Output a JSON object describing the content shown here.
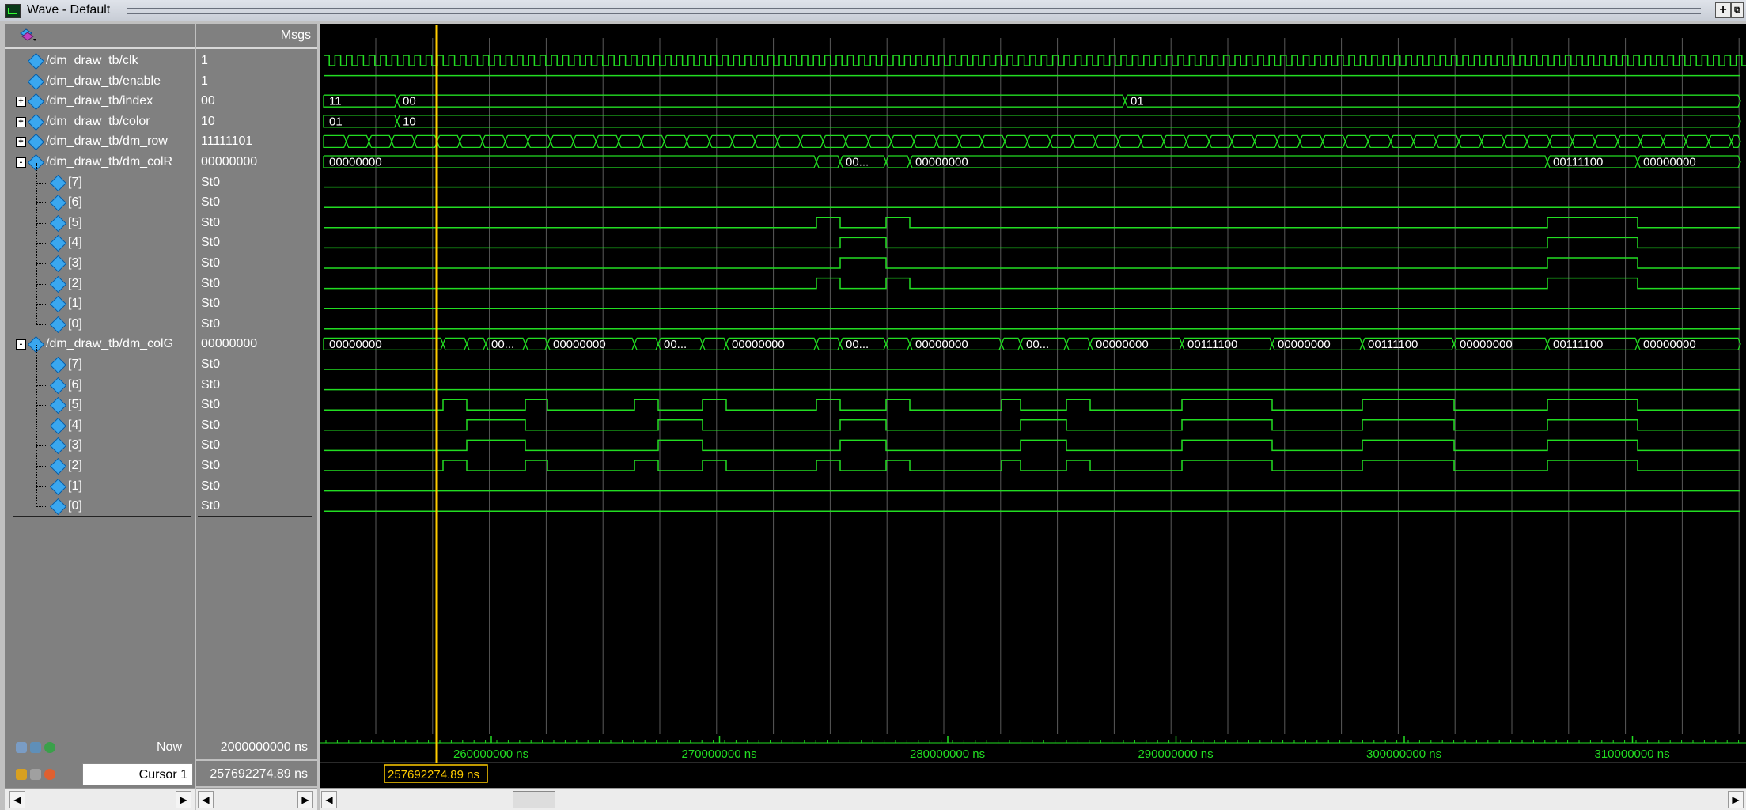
{
  "window": {
    "title": "Wave - Default"
  },
  "header": {
    "msgs_label": "Msgs"
  },
  "signals": [
    {
      "name": "/dm_draw_tb/clk",
      "value": "1",
      "level": 0,
      "expander": ""
    },
    {
      "name": "/dm_draw_tb/enable",
      "value": "1",
      "level": 0,
      "expander": ""
    },
    {
      "name": "/dm_draw_tb/index",
      "value": "00",
      "level": 0,
      "expander": "+"
    },
    {
      "name": "/dm_draw_tb/color",
      "value": "10",
      "level": 0,
      "expander": "+"
    },
    {
      "name": "/dm_draw_tb/dm_row",
      "value": "11111101",
      "level": 0,
      "expander": "+"
    },
    {
      "name": "/dm_draw_tb/dm_colR",
      "value": "00000000",
      "level": 0,
      "expander": "-"
    },
    {
      "name": "[7]",
      "value": "St0",
      "level": 1,
      "expander": ""
    },
    {
      "name": "[6]",
      "value": "St0",
      "level": 1,
      "expander": ""
    },
    {
      "name": "[5]",
      "value": "St0",
      "level": 1,
      "expander": ""
    },
    {
      "name": "[4]",
      "value": "St0",
      "level": 1,
      "expander": ""
    },
    {
      "name": "[3]",
      "value": "St0",
      "level": 1,
      "expander": ""
    },
    {
      "name": "[2]",
      "value": "St0",
      "level": 1,
      "expander": ""
    },
    {
      "name": "[1]",
      "value": "St0",
      "level": 1,
      "expander": ""
    },
    {
      "name": "[0]",
      "value": "St0",
      "level": 1,
      "expander": ""
    },
    {
      "name": "/dm_draw_tb/dm_colG",
      "value": "00000000",
      "level": 0,
      "expander": "-"
    },
    {
      "name": "[7]",
      "value": "St0",
      "level": 1,
      "expander": ""
    },
    {
      "name": "[6]",
      "value": "St0",
      "level": 1,
      "expander": ""
    },
    {
      "name": "[5]",
      "value": "St0",
      "level": 1,
      "expander": ""
    },
    {
      "name": "[4]",
      "value": "St0",
      "level": 1,
      "expander": ""
    },
    {
      "name": "[3]",
      "value": "St0",
      "level": 1,
      "expander": ""
    },
    {
      "name": "[2]",
      "value": "St0",
      "level": 1,
      "expander": ""
    },
    {
      "name": "[1]",
      "value": "St0",
      "level": 1,
      "expander": ""
    },
    {
      "name": "[0]",
      "value": "St0",
      "level": 1,
      "expander": ""
    }
  ],
  "waves": {
    "index_values": [
      "11",
      "00",
      "01"
    ],
    "color_values": [
      "01",
      "10"
    ],
    "colR_values": [
      "00000000",
      "00...",
      "00000000",
      "00111100",
      "00000000"
    ],
    "colG_values": [
      "00000000",
      "00...",
      "00000000",
      "00...",
      "00000000",
      "00...",
      "00000000",
      "00111100",
      "00000000",
      "00111100",
      "00000000",
      "00111100",
      "00000000"
    ]
  },
  "footer": {
    "now_label": "Now",
    "now_value": "2000000000 ns",
    "cursor_label": "Cursor 1",
    "cursor_value": "257692274.89 ns",
    "cursor_flag": "257692274.89 ns",
    "ticks": [
      "260000000 ns",
      "270000000 ns",
      "280000000 ns",
      "290000000 ns",
      "300000000 ns",
      "310000000 ns"
    ]
  },
  "colors": {
    "wave": "#22dd22",
    "cursor": "#ffcc00",
    "background": "#000000",
    "grid": "#5a5a5a"
  }
}
